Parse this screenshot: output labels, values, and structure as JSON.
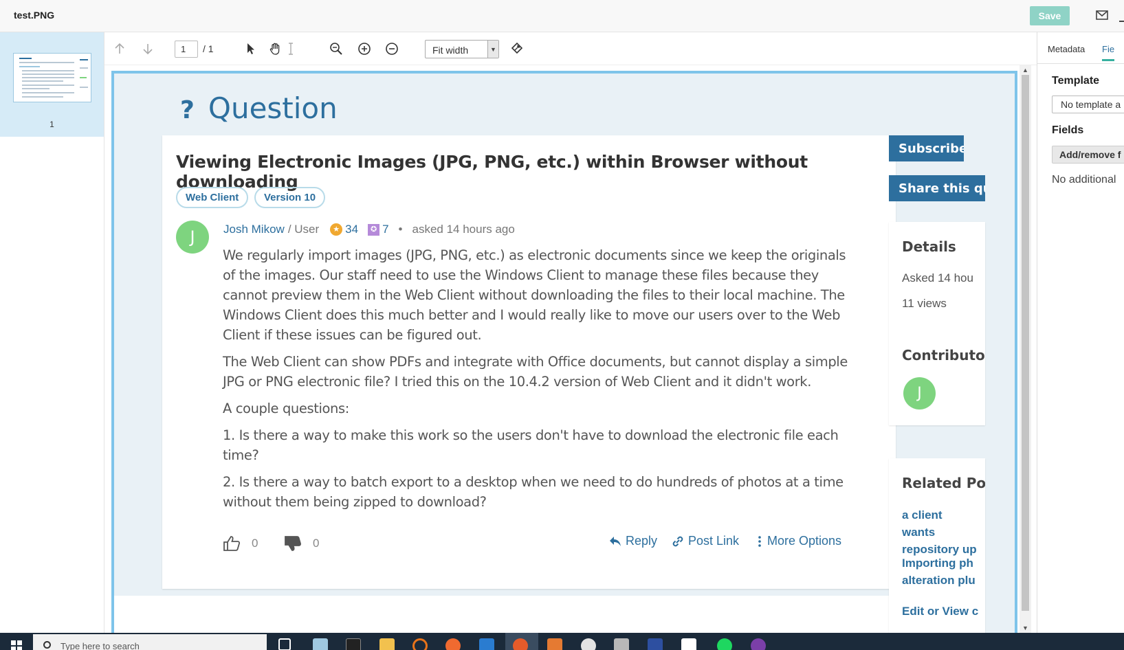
{
  "window": {
    "title": "test.PNG",
    "save_label": "Save"
  },
  "thumbnail": {
    "page_number": "1"
  },
  "toolbar": {
    "page_current": "1",
    "page_total": "/ 1",
    "zoom": "Fit width"
  },
  "question": {
    "heading": "Question",
    "heading_icon": "?",
    "title": "Viewing Electronic Images (JPG, PNG, etc.) within Browser without downloading",
    "tags": [
      "Web Client",
      "Version 10"
    ],
    "author": {
      "initial": "J",
      "name": "Josh Mikow",
      "role": "/ User",
      "reputation": "34",
      "badges": "7",
      "dot": "•",
      "asked": "asked 14 hours ago",
      "avatar_color": "#7ed47f"
    },
    "body": [
      "We regularly import images (JPG, PNG, etc.) as electronic documents since we keep the originals of the images. Our staff need to use the Windows Client to manage these files because they cannot preview them in the Web Client without downloading the files to their local machine. The Windows Client does this much better and I would really like to move our users over to the Web Client if these issues can be figured out.",
      "The Web Client can show PDFs and integrate with Office documents, but cannot display a simple JPG or PNG electronic file? I tried this on the 10.4.2 version of Web Client and it didn't work.",
      "A couple questions:",
      "1. Is there a way to make this work so the users don't have to download the electronic file each time?",
      "2. Is there a way to batch export to a desktop when we need to do hundreds of photos at a time without them being zipped to download?"
    ],
    "upvotes": "0",
    "downvotes": "0",
    "actions": {
      "reply": "Reply",
      "post_link": "Post Link",
      "more_options": "More Options"
    }
  },
  "sidebar": {
    "subscribe": "Subscribe",
    "share": "Share this que",
    "details": {
      "heading": "Details",
      "asked": "Asked 14 hou",
      "views": "11 views"
    },
    "contributors": {
      "heading": "Contributor",
      "initial": "J"
    },
    "related": {
      "heading": "Related Pos",
      "links": [
        "a client wants repository up",
        "Importing ph alteration plu",
        "Edit or View c"
      ]
    }
  },
  "right_panel": {
    "tabs": [
      "Metadata",
      "Fie"
    ],
    "template_label": "Template",
    "template_value": "No template a",
    "fields_label": "Fields",
    "fields_button": "Add/remove f",
    "fields_text": "No additional"
  },
  "taskbar": {
    "search_placeholder": "Type here to search"
  },
  "colors": {
    "brand": "#2d6f9e",
    "accent": "#37b0a0",
    "save": "#8fd3c6",
    "frame": "#7ec4ea"
  }
}
